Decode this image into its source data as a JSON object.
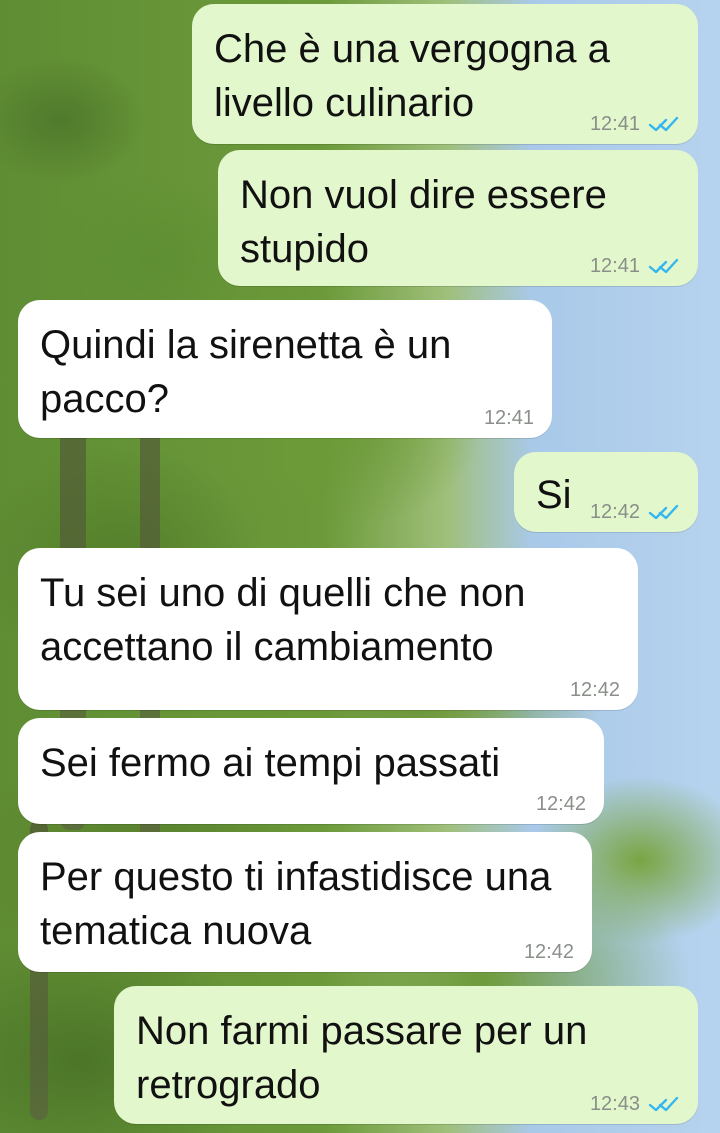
{
  "messages": [
    {
      "direction": "out",
      "text": "Che è una vergogna a livello culinario",
      "time": "12:41",
      "status": "read"
    },
    {
      "direction": "out",
      "text": "Non vuol dire essere stupido",
      "time": "12:41",
      "status": "read"
    },
    {
      "direction": "in",
      "text": "Quindi la sirenetta è un pacco?",
      "time": "12:41"
    },
    {
      "direction": "out",
      "text": "Si",
      "time": "12:42",
      "status": "read"
    },
    {
      "direction": "in",
      "text": "Tu sei uno di quelli che non accettano il cambiamento",
      "time": "12:42"
    },
    {
      "direction": "in",
      "text": "Sei fermo ai tempi passati",
      "time": "12:42"
    },
    {
      "direction": "in",
      "text": "Per questo ti infastidisce una tematica nuova",
      "time": "12:42"
    },
    {
      "direction": "out",
      "text": "Non farmi passare per un retrogrado",
      "time": "12:43",
      "status": "read"
    }
  ],
  "colors": {
    "outgoing_bubble": "#e2f7cb",
    "incoming_bubble": "#ffffff",
    "read_ticks": "#34b7f1",
    "timestamp": "#8a8f8a"
  },
  "icons": {
    "read_receipt": "double-check-icon"
  }
}
